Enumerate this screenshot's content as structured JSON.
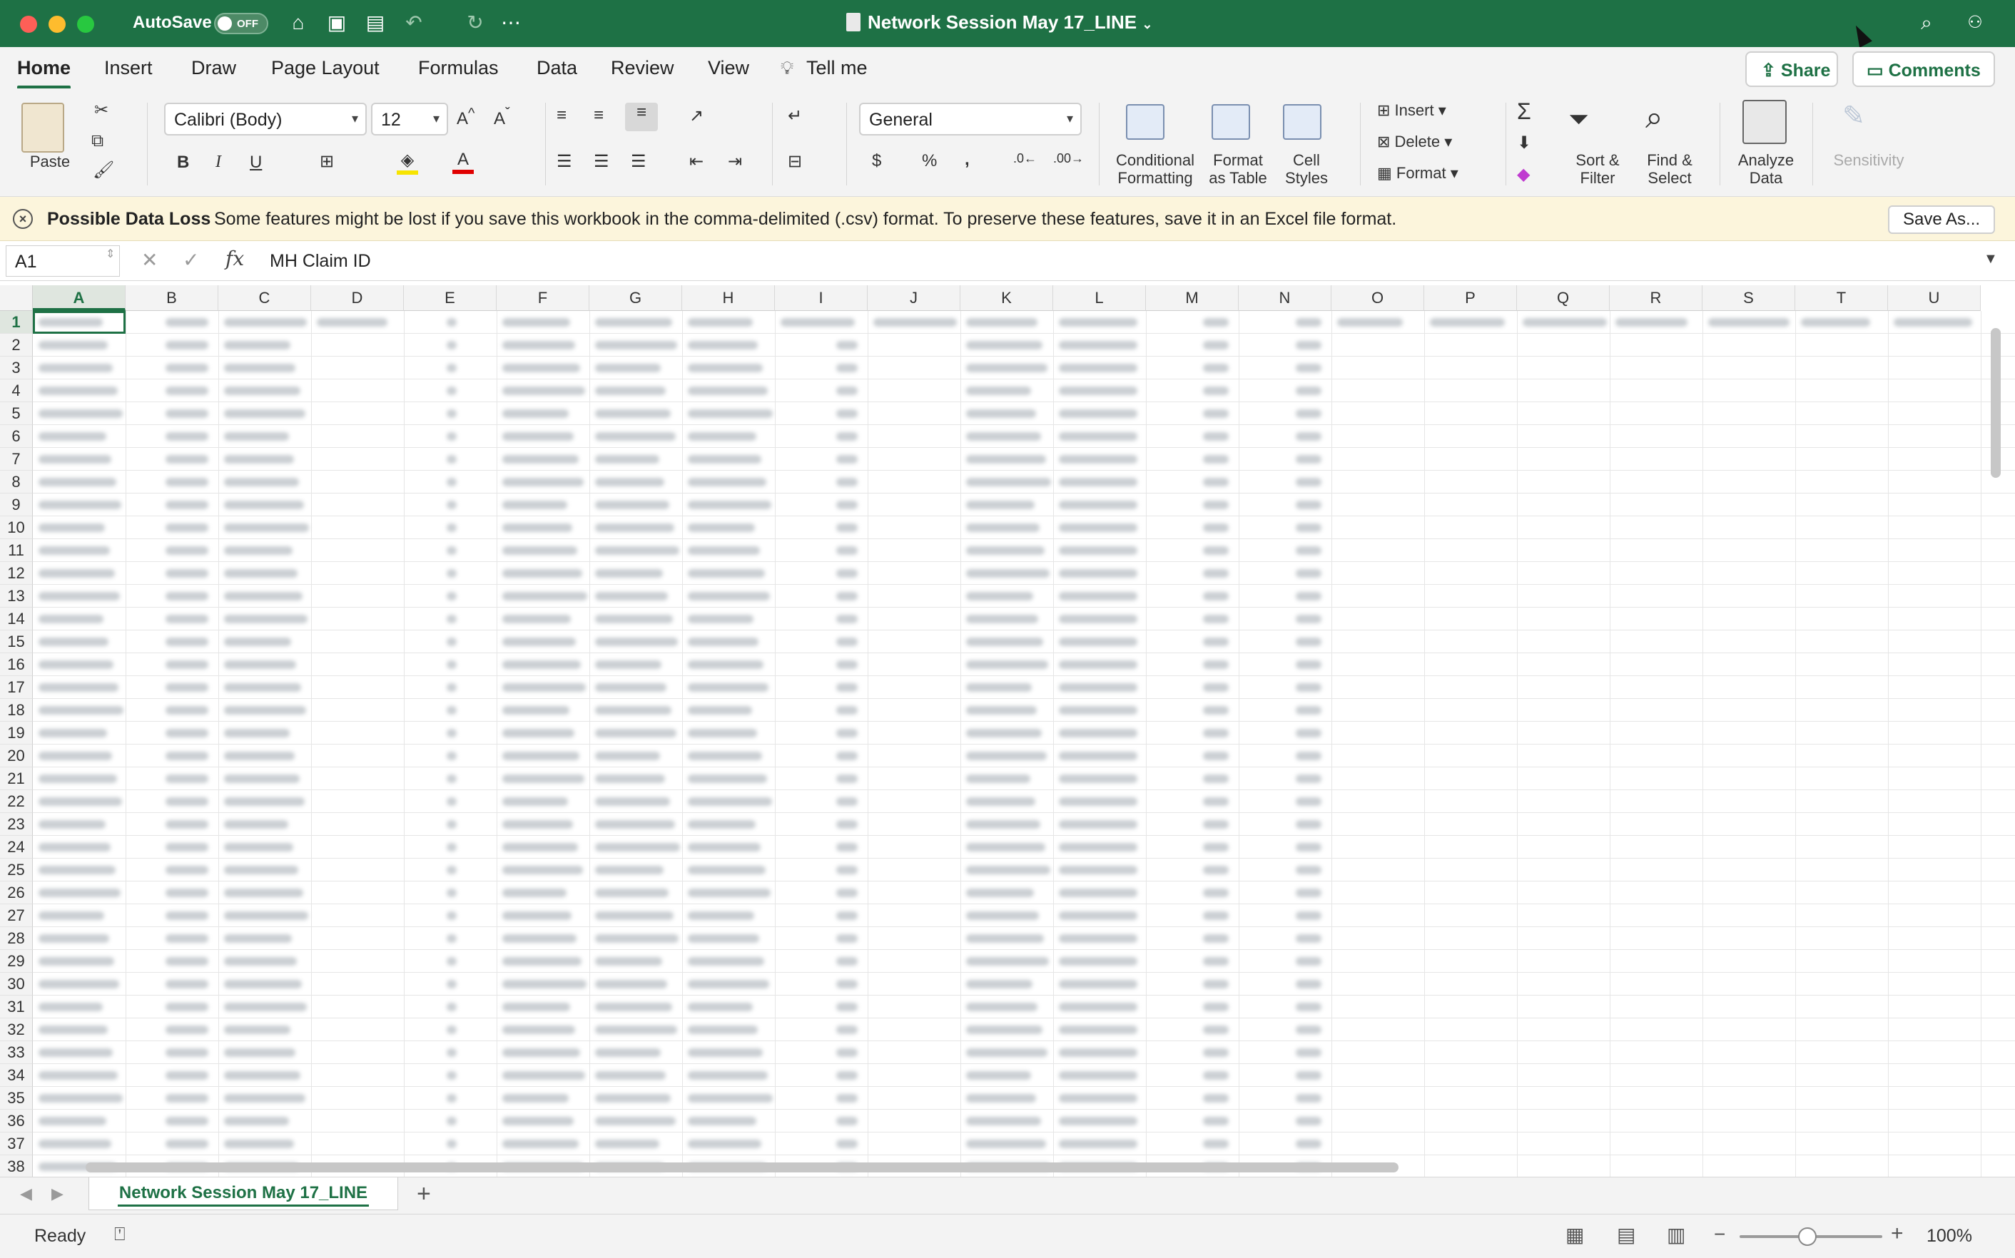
{
  "titlebar": {
    "autosave_label": "AutoSave",
    "autosave_state": "OFF",
    "document_title": "Network Session May 17_LINE"
  },
  "ribbon_tabs": [
    "Home",
    "Insert",
    "Draw",
    "Page Layout",
    "Formulas",
    "Data",
    "Review",
    "View",
    "Tell me"
  ],
  "active_tab": "Home",
  "share_label": "Share",
  "comments_label": "Comments",
  "ribbon": {
    "paste_label": "Paste",
    "font_name": "Calibri (Body)",
    "font_size": "12",
    "number_format": "General",
    "bold": "B",
    "italic": "I",
    "underline": "U",
    "conditional_formatting": "Conditional\nFormatting",
    "format_as_table": "Format\nas Table",
    "cell_styles": "Cell\nStyles",
    "insert_label": "Insert",
    "delete_label": "Delete",
    "format_label": "Format",
    "sort_filter": "Sort &\nFilter",
    "find_select": "Find &\nSelect",
    "analyze_data": "Analyze\nData",
    "sensitivity": "Sensitivity"
  },
  "message_bar": {
    "title": "Possible Data Loss",
    "text": "Some features might be lost if you save this workbook in the comma-delimited (.csv) format. To preserve these features, save it in an Excel file format.",
    "button": "Save As..."
  },
  "formula_bar": {
    "cell_ref": "A1",
    "fx": "fx",
    "content": "MH Claim ID"
  },
  "columns": [
    "A",
    "B",
    "C",
    "D",
    "E",
    "F",
    "G",
    "H",
    "I",
    "J",
    "K",
    "L",
    "M",
    "N",
    "O",
    "P",
    "Q",
    "R",
    "S",
    "T",
    "U"
  ],
  "rows": [
    "1",
    "2",
    "3",
    "4",
    "5",
    "6",
    "7",
    "8",
    "9",
    "10",
    "11",
    "12",
    "13",
    "14",
    "15",
    "16",
    "17",
    "18",
    "19",
    "20",
    "21",
    "22",
    "23",
    "24",
    "25",
    "26",
    "27",
    "28",
    "29",
    "30",
    "31",
    "32",
    "33",
    "34",
    "35",
    "36",
    "37",
    "38"
  ],
  "sheet_tab": "Network Session May 17_LINE",
  "status": {
    "ready": "Ready",
    "zoom": "100%"
  },
  "colors": {
    "excel_green": "#1e7145",
    "message_bar": "#fcf5dc"
  }
}
